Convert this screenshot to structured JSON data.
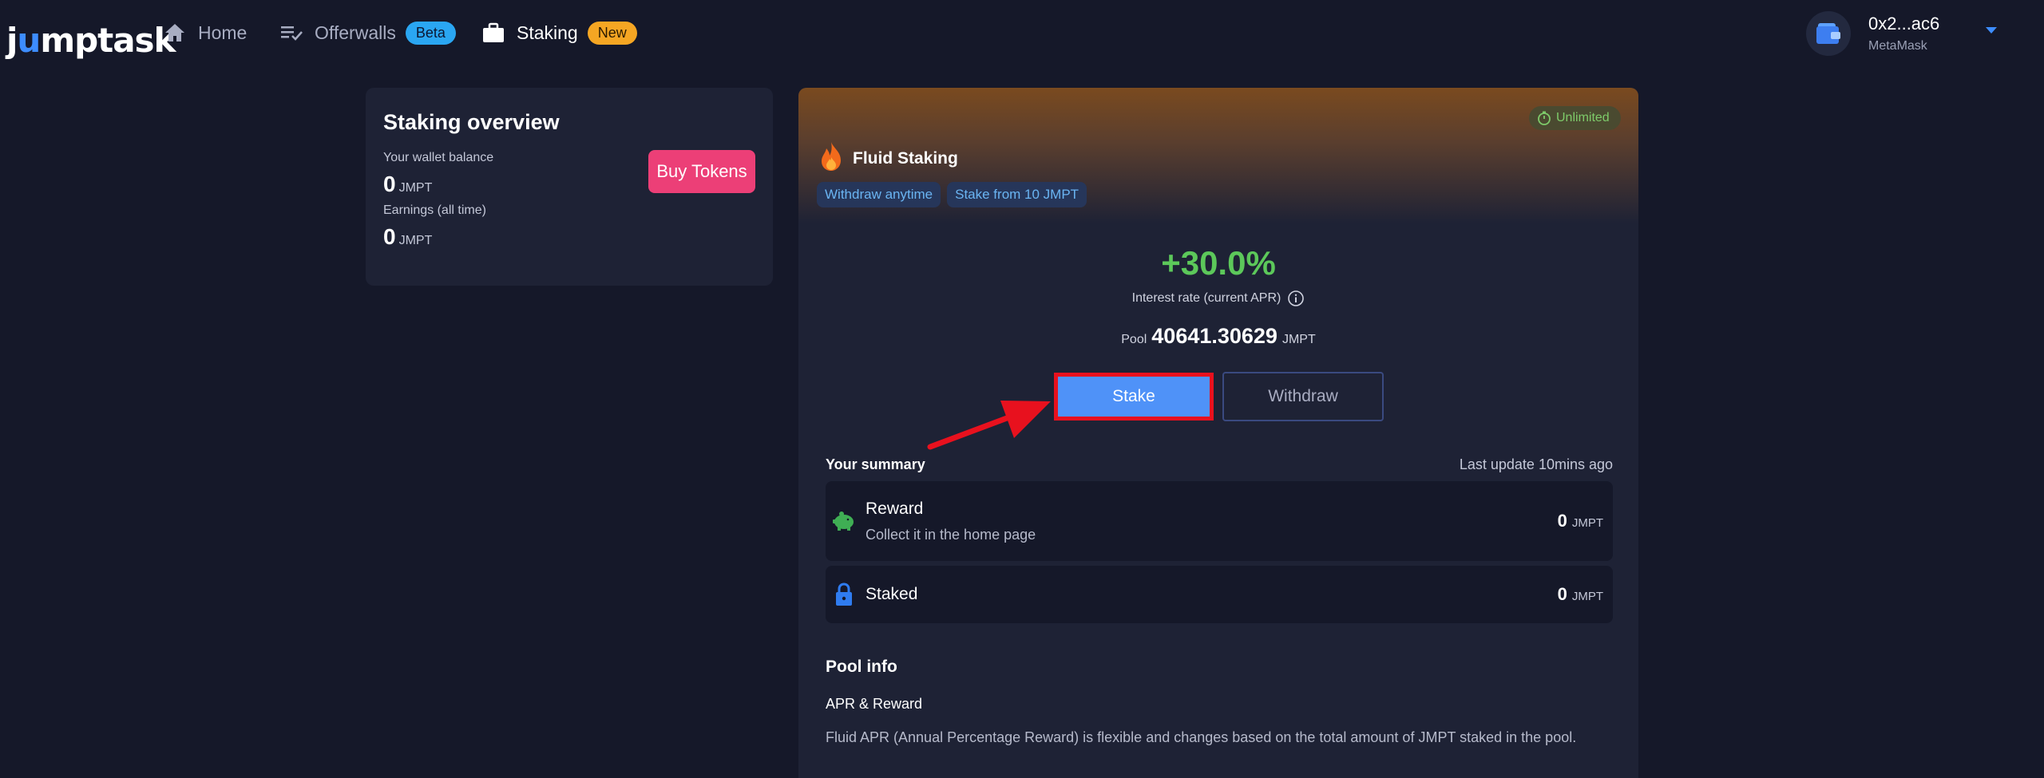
{
  "header": {
    "logo": "jumptask",
    "nav": [
      {
        "label": "Home",
        "icon": "home-icon"
      },
      {
        "label": "Offerwalls",
        "icon": "list-check-icon",
        "badge": "Beta"
      },
      {
        "label": "Staking",
        "icon": "briefcase-icon",
        "badge": "New"
      }
    ],
    "wallet": {
      "address": "0x2...ac6",
      "provider": "MetaMask",
      "icon": "wallet-icon"
    }
  },
  "overview": {
    "title": "Staking overview",
    "wallet_balance_label": "Your wallet balance",
    "wallet_balance_value": "0",
    "wallet_balance_unit": "JMPT",
    "earnings_label": "Earnings (all time)",
    "earnings_value": "0",
    "earnings_unit": "JMPT",
    "buy_button": "Buy Tokens"
  },
  "fluid": {
    "badge": "Unlimited",
    "title": "Fluid Staking",
    "tags": [
      "Withdraw anytime",
      "Stake from 10 JMPT"
    ],
    "apr": "+30.0%",
    "apr_label": "Interest rate (current APR)",
    "pool_label": "Pool",
    "pool_value": "40641.30629",
    "pool_unit": "JMPT",
    "stake_button": "Stake",
    "withdraw_button": "Withdraw",
    "summary_title": "Your summary",
    "last_update": "Last update 10mins ago",
    "reward": {
      "title": "Reward",
      "subtitle": "Collect it in the home page",
      "value": "0",
      "unit": "JMPT"
    },
    "staked": {
      "title": "Staked",
      "value": "0",
      "unit": "JMPT"
    },
    "pool_info_title": "Pool info",
    "apr_reward_title": "APR & Reward",
    "apr_reward_desc": "Fluid APR (Annual Percentage Reward) is flexible and changes based on the total amount of JMPT staked in the pool."
  },
  "colors": {
    "background": "#151829",
    "card": "#1e2235",
    "accent_blue": "#4f92f8",
    "buy_pink": "#ec3f77",
    "apr_green": "#5cc85a",
    "highlight_red": "#e8111e"
  }
}
